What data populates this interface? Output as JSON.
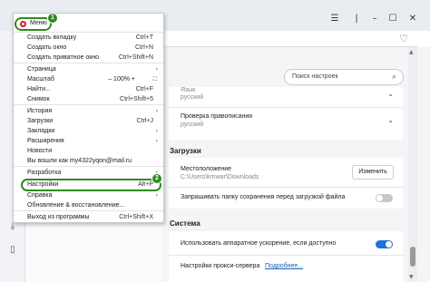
{
  "window": {
    "minimize": "–",
    "maximize": "☐",
    "close": "✕",
    "filter_icon": "☰",
    "favorite_icon": "♡"
  },
  "search": {
    "placeholder": "Поиск настроек",
    "icon": "⌕"
  },
  "language": {
    "label": "Язык",
    "value": "русский"
  },
  "spellcheck": {
    "label": "Проверка правописания",
    "value": "русский"
  },
  "downloads": {
    "section": "Загрузки",
    "location_label": "Местоположение",
    "location_path": "C:\\Users\\kmwar\\Downloads",
    "change_button": "Изменить",
    "ask_label": "Запрашивать папку сохранения перед загрузкой файла",
    "ask_enabled": false
  },
  "system": {
    "section": "Система",
    "hw_accel_label": "Использовать аппаратное ускорение, если доступно",
    "hw_accel_enabled": true,
    "proxy_label": "Настройки прокси-сервера",
    "proxy_link": "Подробнее..."
  },
  "menu": {
    "button_label": "Меню",
    "zoom_value": "100%",
    "items": [
      {
        "label": "Создать вкладку",
        "shortcut": "Ctrl+T"
      },
      {
        "label": "Создать окно",
        "shortcut": "Ctrl+N"
      },
      {
        "label": "Создать приватное окно",
        "shortcut": "Ctrl+Shift+N"
      },
      {
        "label": "Страница",
        "shortcut": ""
      },
      {
        "label": "Масштаб",
        "shortcut": ""
      },
      {
        "label": "Найти...",
        "shortcut": "Ctrl+F"
      },
      {
        "label": "Снимок",
        "shortcut": "Ctrl+Shift+5"
      },
      {
        "label": "История",
        "shortcut": ""
      },
      {
        "label": "Загрузки",
        "shortcut": "Ctrl+J"
      },
      {
        "label": "Закладки",
        "shortcut": ""
      },
      {
        "label": "Расширения",
        "shortcut": ""
      },
      {
        "label": "Новости",
        "shortcut": ""
      },
      {
        "label": "Вы вошли как my4322yqon@mail.ru",
        "shortcut": ""
      },
      {
        "label": "Разработка",
        "shortcut": ""
      },
      {
        "label": "Настройки",
        "shortcut": "Alt+P"
      },
      {
        "label": "Справка",
        "shortcut": ""
      },
      {
        "label": "Обновление & восстановление...",
        "shortcut": ""
      },
      {
        "label": "Выход из программы",
        "shortcut": "Ctrl+Shift+X"
      }
    ],
    "zoom_minus": "–",
    "zoom_plus": "+",
    "fullscreen_icon": "⛶",
    "submenu_arrow": "›"
  },
  "callouts": [
    "1",
    "2"
  ],
  "accent_color": "#2e8b1f",
  "toggle_on_color": "#1f72d6",
  "toggle_off_color": "#c7c7c7"
}
